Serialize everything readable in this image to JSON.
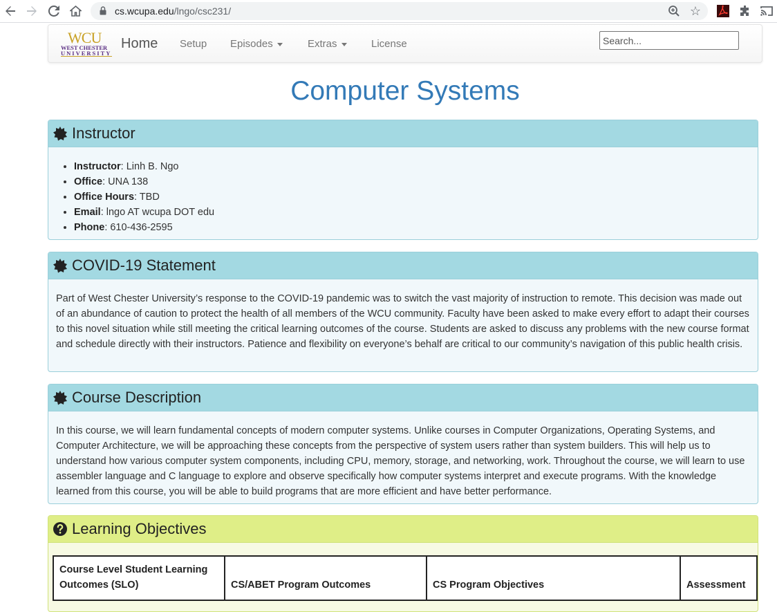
{
  "browser": {
    "url_host": "cs.wcupa.edu",
    "url_path": "/lngo/csc231/"
  },
  "navbar": {
    "logo_text": "WCU",
    "logo_line1": "WEST CHESTER",
    "logo_line2": "UNIVERSITY",
    "brand": "Home",
    "items": [
      {
        "label": "Setup"
      },
      {
        "label": "Episodes"
      },
      {
        "label": "Extras"
      },
      {
        "label": "License"
      }
    ],
    "search_placeholder": "Search..."
  },
  "page_title": "Computer Systems",
  "instructor": {
    "heading": "Instructor",
    "items": [
      {
        "label": "Instructor",
        "value": ": Linh B. Ngo"
      },
      {
        "label": "Office",
        "value": ": UNA 138"
      },
      {
        "label": "Office Hours",
        "value": ": TBD"
      },
      {
        "label": "Email",
        "value": ": lngo AT wcupa DOT edu"
      },
      {
        "label": "Phone",
        "value": ": 610-436-2595"
      }
    ]
  },
  "covid": {
    "heading": "COVID-19 Statement",
    "text": "Part of West Chester University’s response to the COVID-19 pandemic was to switch the vast majority of instruction to remote. This decision was made out of an abundance of caution to protect the health of all members of the WCU community. Faculty have been asked to make every effort to adapt their courses to this novel situation while still meeting the critical learning outcomes of the course. Students are asked to discuss any problems with the new course format and schedule directly with their instructors. Patience and flexibility on everyone’s behalf are critical to our community’s navigation of this public health crisis."
  },
  "description": {
    "heading": "Course Description",
    "text": "In this course, we will learn fundamental concepts of modern computer systems. Unlike courses in Computer Organizations, Operating Systems, and Computer Architecture, we will be approaching these concepts from the perspective of system users rather than system builders. This will help us to understand how various computer system components, including CPU, memory, storage, and networking, work. Throughout the course, we will learn to use assembler language and C language to explore and observe specifically how computer systems interpret and execute programs. With the knowledge learned from this course, you will be able to build programs that are more efficient and have better performance."
  },
  "objectives": {
    "heading": "Learning Objectives",
    "columns": [
      "Course Level Student Learning Outcomes (SLO)",
      "CS/ABET Program Outcomes",
      "CS Program Objectives",
      "Assessment"
    ]
  },
  "colors": {
    "title": "#337ab7",
    "info_heading": "#a3d9e2",
    "objectives_heading": "#dfee87"
  }
}
